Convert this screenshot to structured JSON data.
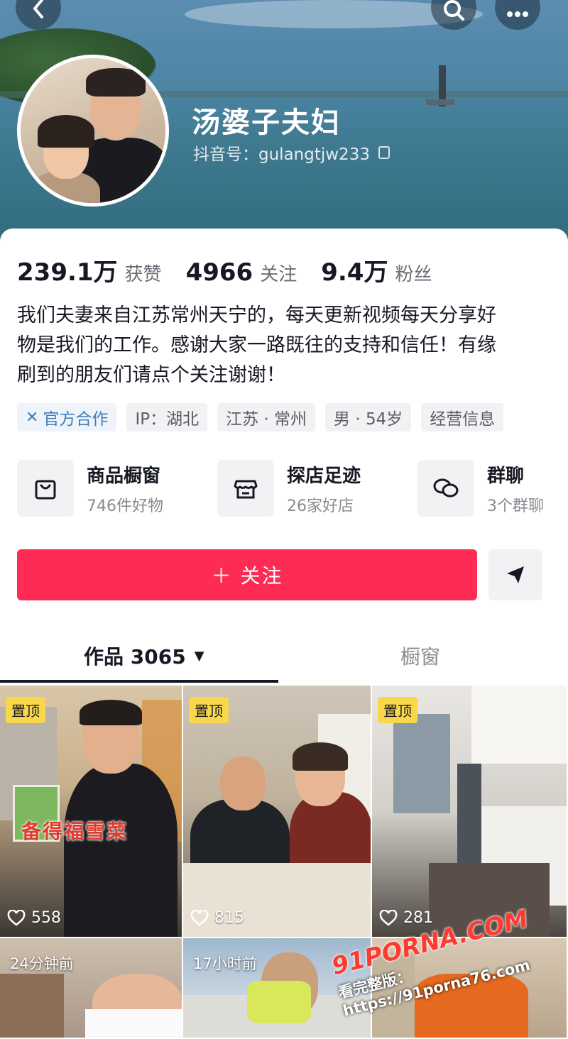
{
  "header": {
    "back_icon": "chevron-left-icon",
    "search_icon": "search-icon",
    "more_icon": "more-dots-icon"
  },
  "profile": {
    "name": "汤婆子夫妇",
    "douyin_id": "抖音号：gulangtjw233"
  },
  "stats": [
    {
      "value": "239.1万",
      "label": "获赞"
    },
    {
      "value": "4966",
      "label": "关注"
    },
    {
      "value": "9.4万",
      "label": "粉丝"
    }
  ],
  "bio": {
    "line1": "我们夫妻来自江苏常州天宁的，每天更新视频每天分享好",
    "line2": "物是我们的工作。感谢大家一路既往的支持和信任！有缘",
    "line3": "刷到的朋友们请点个关注谢谢！"
  },
  "tags": [
    "官方合作",
    "IP：湖北",
    "江苏 · 常州",
    "男 · 54岁",
    "经营信息"
  ],
  "features": [
    {
      "title": "商品橱窗",
      "sub": "746件好物",
      "icon": "shopping-bag-icon"
    },
    {
      "title": "探店足迹",
      "sub": "26家好店",
      "icon": "shop-icon"
    },
    {
      "title": "群聊",
      "sub": "3个群聊",
      "icon": "chat-bubbles-icon"
    }
  ],
  "actions": {
    "follow_label": "＋ 关注",
    "share_icon": "send-icon"
  },
  "tabs": {
    "works_label": "作品 3065",
    "window_label": "橱窗"
  },
  "videos": [
    {
      "badge": "置顶",
      "likes": "558",
      "caption": "备得福雪菜"
    },
    {
      "badge": "置顶",
      "likes": "815"
    },
    {
      "badge": "置顶",
      "likes": "281"
    },
    {
      "time": "24分钟前"
    },
    {
      "time": "17小时前"
    },
    {
      "time": ""
    }
  ],
  "watermark": {
    "line1": "91PORNA.COM",
    "line2": "看完整版：https://91porna76.com"
  },
  "colors": {
    "accent": "#fe2c55",
    "pin_badge": "#f8d84a",
    "official_tag": "#3e7fb8"
  }
}
